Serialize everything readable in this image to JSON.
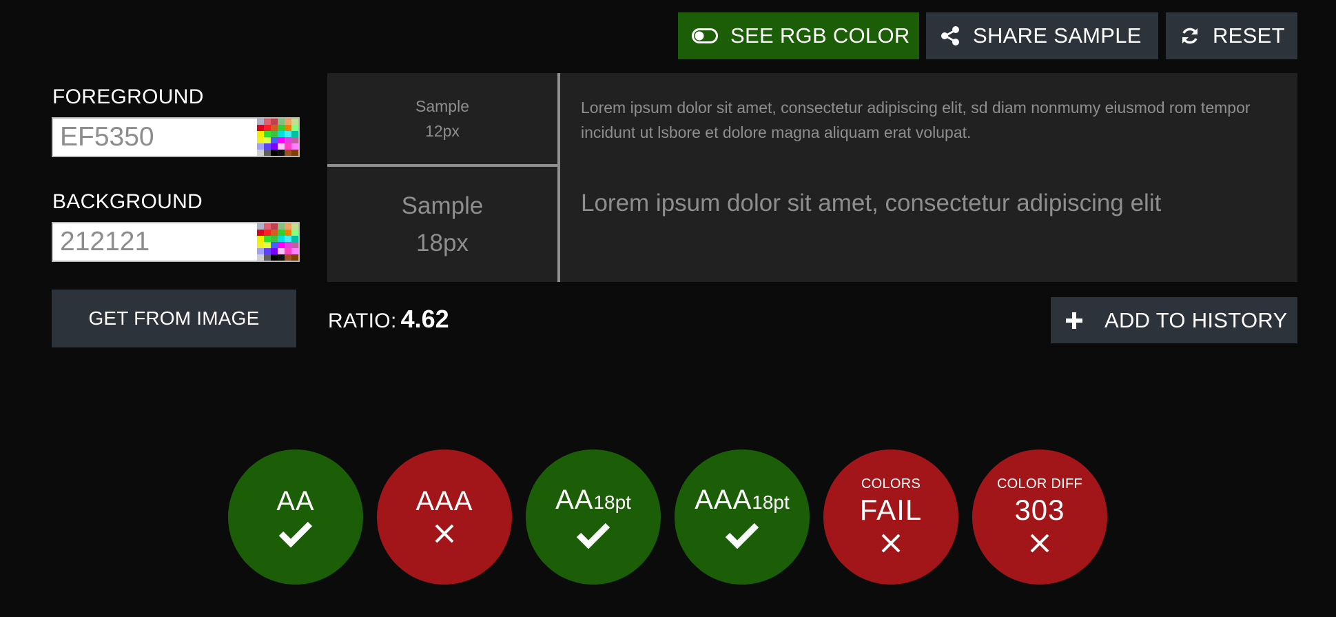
{
  "toolbar": {
    "rgb_label": "SEE RGB COLOR",
    "share_label": "SHARE SAMPLE",
    "reset_label": "RESET"
  },
  "left": {
    "foreground_label": "FOREGROUND",
    "foreground_value": "EF5350",
    "background_label": "BACKGROUND",
    "background_value": "212121",
    "image_button": "GET FROM IMAGE"
  },
  "sample": {
    "small_label_line1": "Sample",
    "small_label_line2": "12px",
    "large_label_line1": "Sample",
    "large_label_line2": "18px",
    "small_text": "Lorem ipsum dolor sit amet, consectetur adipiscing elit, sd diam nonmumy eiusmod rom tempor incidunt ut lsbore et dolore magna aliquam erat volupat.",
    "large_text": "Lorem ipsum dolor sit amet, consectetur adipiscing elit"
  },
  "ratio": {
    "label": "RATIO:",
    "value": "4.62"
  },
  "history_button": "ADD TO HISTORY",
  "results": {
    "aa": {
      "title": "AA",
      "status": "pass"
    },
    "aaa": {
      "title": "AAA",
      "status": "fail"
    },
    "aa18": {
      "title": "AA",
      "suffix": "18pt",
      "status": "pass"
    },
    "aaa18": {
      "title": "AAA",
      "suffix": "18pt",
      "status": "pass"
    },
    "colors": {
      "caption": "COLORS",
      "value": "FAIL",
      "status": "fail"
    },
    "diff": {
      "caption": "COLOR DIFF",
      "value": "303",
      "status": "fail"
    }
  },
  "colors": {
    "pass": "#1b5e07",
    "fail": "#a21518",
    "button": "#2d333b",
    "sample_bg": "#212121",
    "page_bg": "#0b0b0b"
  }
}
